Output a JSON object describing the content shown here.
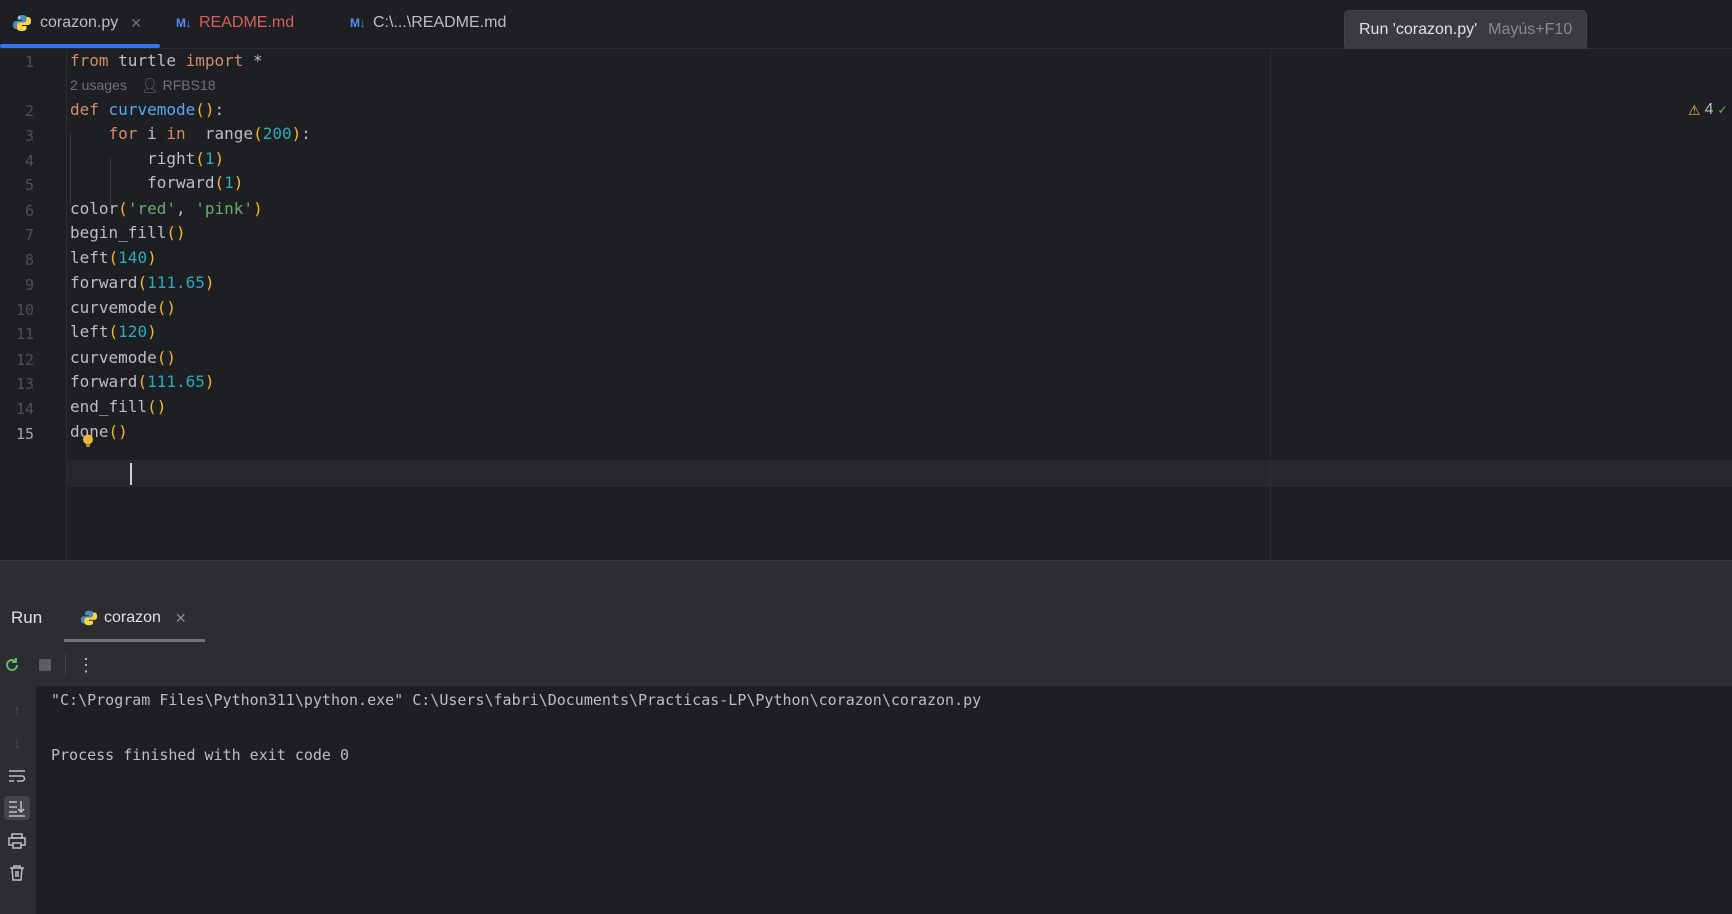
{
  "tabs": [
    {
      "label": "corazon.py",
      "icon": "python-icon",
      "active": true
    },
    {
      "label": "README.md",
      "icon": "markdown-icon",
      "badge": "M↓"
    },
    {
      "label": "C:\\...\\README.md",
      "icon": "markdown-icon",
      "badge": "M↓"
    }
  ],
  "tooltip": {
    "label": "Run 'corazon.py'",
    "shortcut": "Mayús+F10"
  },
  "editor": {
    "warning_count": "4",
    "inlay": {
      "usages": "2 usages",
      "author": "RFBS18"
    },
    "line_numbers": [
      "1",
      "2",
      "3",
      "4",
      "5",
      "6",
      "7",
      "8",
      "9",
      "10",
      "11",
      "12",
      "13",
      "14",
      "15"
    ],
    "current_line": "15",
    "lines": [
      "from turtle import *",
      "def curvemode():",
      "    for i in  range(200):",
      "        right(1)",
      "        forward(1)",
      "color('red', 'pink')",
      "begin_fill()",
      "left(140)",
      "forward(111.65)",
      "curvemode()",
      "left(120)",
      "curvemode()",
      "forward(111.65)",
      "end_fill()",
      "done()"
    ]
  },
  "run_panel": {
    "title": "Run",
    "tab_label": "corazon",
    "console": [
      "\"C:\\Program Files\\Python311\\python.exe\" C:\\Users\\fabri\\Documents\\Practicas-LP\\Python\\corazon\\corazon.py",
      "",
      "Process finished with exit code 0"
    ]
  },
  "colors": {
    "background": "#1e1f22",
    "panel": "#2b2d30",
    "accent": "#3574f0",
    "keyword": "#cf8e6d",
    "function": "#56a8f5",
    "number": "#2aacb8",
    "string": "#6aab73"
  }
}
